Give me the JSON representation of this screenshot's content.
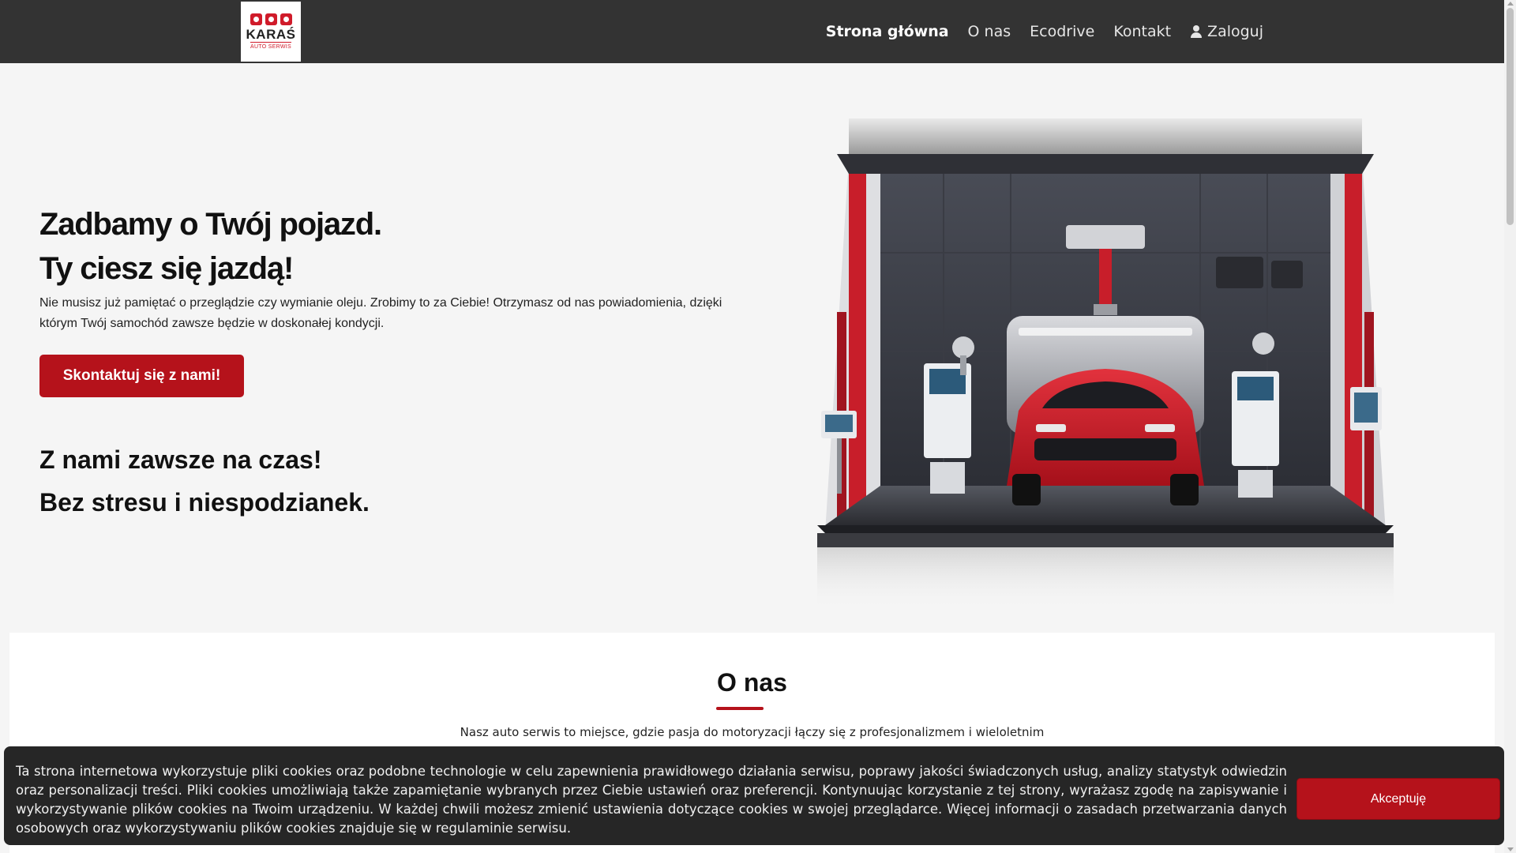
{
  "logo": {
    "name": "KARAŚ",
    "subtitle": "AUTO SERWIS"
  },
  "nav": {
    "items": [
      {
        "label": "Strona główna",
        "active": true
      },
      {
        "label": "O nas"
      },
      {
        "label": "Ecodrive"
      },
      {
        "label": "Kontakt"
      },
      {
        "label": "Zaloguj",
        "icon": "user-icon"
      }
    ]
  },
  "hero": {
    "headline_line1": "Zadbamy o Twój pojazd.",
    "headline_line2": "Ty ciesz się jazdą!",
    "description": "Nie musisz już pamiętać o przeglądzie czy wymianie oleju. Zrobimy to za Ciebie! Otrzymasz od nas powiadomienia, dzięki którym Twój samochód zawsze będzie w doskonałej kondycji.",
    "cta_label": "Skontaktuj się z nami!",
    "subheadline_line1": "Z nami zawsze na czas!",
    "subheadline_line2": "Bez stresu i niespodzianek.",
    "image": "garage-illustration"
  },
  "about": {
    "title": "O nas",
    "text": "Nasz auto serwis to miejsce, gdzie pasja do motoryzacji łączy się z profesjonalizmem i wieloletnim"
  },
  "cookie": {
    "text": "Ta strona internetowa wykorzystuje pliki cookies oraz podobne technologie w celu zapewnienia prawidłowego działania serwisu, poprawy jakości świadczonych usług, analizy statystyk odwiedzin oraz personalizacji treści. Pliki cookies umożliwiają także zapamiętanie wybranych przez Ciebie ustawień oraz preferencji. Kontynuując korzystanie z tej strony, wyrażasz zgodę na zapisywanie i wykorzystywanie plików cookies na Twoim urządzeniu. W każdej chwili możesz zmienić ustawienia dotyczące cookies w swojej przeglądarce. Więcej informacji o zasadach przetwarzania danych osobowych oraz wykorzystywaniu plików cookies znajduje się w regulaminie serwisu.",
    "accept_label": "Akceptuję"
  },
  "colors": {
    "navbar": "#333333",
    "accent": "#b5121b",
    "background": "#f5f5f5",
    "cookie_bar": "#262626"
  }
}
